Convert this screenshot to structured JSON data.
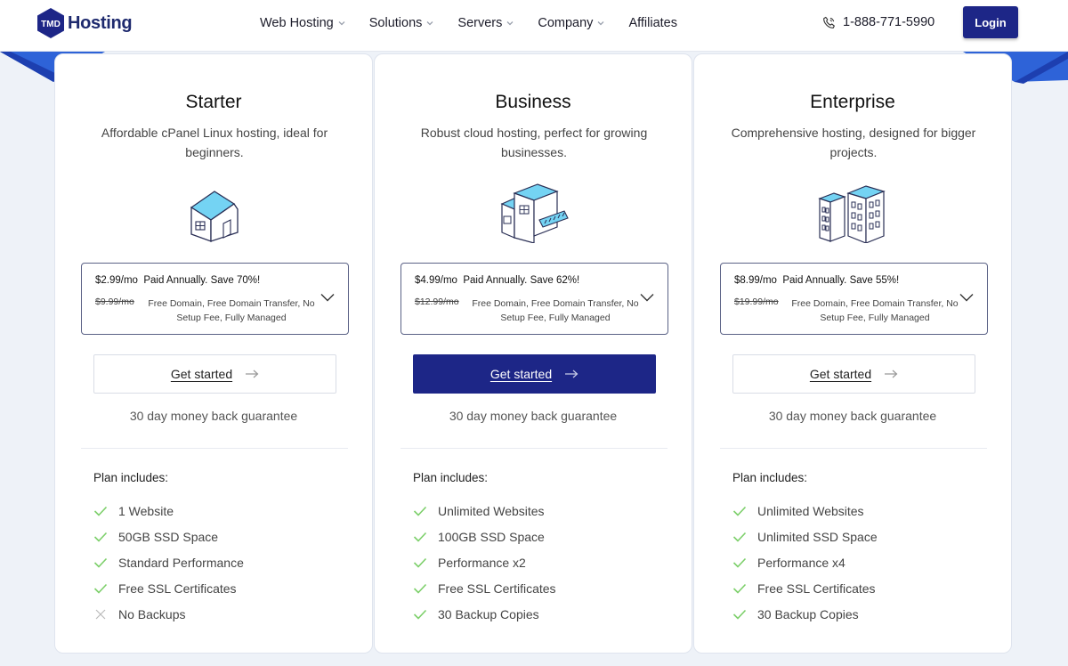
{
  "header": {
    "logo_badge": "TMD",
    "logo_text": "Hosting",
    "nav": [
      {
        "label": "Web Hosting",
        "has_dropdown": true
      },
      {
        "label": "Solutions",
        "has_dropdown": true
      },
      {
        "label": "Servers",
        "has_dropdown": true
      },
      {
        "label": "Company",
        "has_dropdown": true
      },
      {
        "label": "Affiliates",
        "has_dropdown": false
      }
    ],
    "phone": "1-888-771-5990",
    "login_label": "Login"
  },
  "colors": {
    "brand": "#1d2687",
    "accent_blue": "#2b5fd6",
    "check_green": "#7ccf6a",
    "illustration_blue": "#6fd3f5"
  },
  "plans": [
    {
      "name": "Starter",
      "description": "Affordable cPanel Linux hosting, ideal for beginners.",
      "illustration": "house-icon",
      "price": "$2.99/mo",
      "billing": "Paid Annually. Save 70%!",
      "old_price": "$9.99/mo",
      "price_features": "Free Domain, Free Domain Transfer, No Setup Fee, Fully Managed",
      "cta_label": "Get started",
      "cta_primary": false,
      "guarantee": "30 day money back guarantee",
      "includes_title": "Plan includes:",
      "features": [
        {
          "text": "1 Website",
          "included": true
        },
        {
          "text": "50GB SSD Space",
          "included": true
        },
        {
          "text": "Standard Performance",
          "included": true
        },
        {
          "text": "Free SSL Certificates",
          "included": true
        },
        {
          "text": "No Backups",
          "included": false
        }
      ]
    },
    {
      "name": "Business",
      "description": "Robust cloud hosting, perfect for growing businesses.",
      "illustration": "storefront-icon",
      "price": "$4.99/mo",
      "billing": "Paid Annually. Save 62%!",
      "old_price": "$12.99/mo",
      "price_features": "Free Domain, Free Domain Transfer, No Setup Fee, Fully Managed",
      "cta_label": "Get started",
      "cta_primary": true,
      "guarantee": "30 day money back guarantee",
      "includes_title": "Plan includes:",
      "features": [
        {
          "text": "Unlimited Websites",
          "included": true
        },
        {
          "text": "100GB SSD Space",
          "included": true
        },
        {
          "text": "Performance x2",
          "included": true
        },
        {
          "text": "Free SSL Certificates",
          "included": true
        },
        {
          "text": "30 Backup Copies",
          "included": true
        }
      ]
    },
    {
      "name": "Enterprise",
      "description": "Comprehensive hosting, designed for bigger projects.",
      "illustration": "office-buildings-icon",
      "price": "$8.99/mo",
      "billing": "Paid Annually. Save 55%!",
      "old_price": "$19.99/mo",
      "price_features": "Free Domain, Free Domain Transfer, No Setup Fee, Fully Managed",
      "cta_label": "Get started",
      "cta_primary": false,
      "guarantee": "30 day money back guarantee",
      "includes_title": "Plan includes:",
      "features": [
        {
          "text": "Unlimited Websites",
          "included": true
        },
        {
          "text": "Unlimited SSD Space",
          "included": true
        },
        {
          "text": "Performance x4",
          "included": true
        },
        {
          "text": "Free SSL Certificates",
          "included": true
        },
        {
          "text": "30 Backup Copies",
          "included": true
        }
      ]
    }
  ]
}
